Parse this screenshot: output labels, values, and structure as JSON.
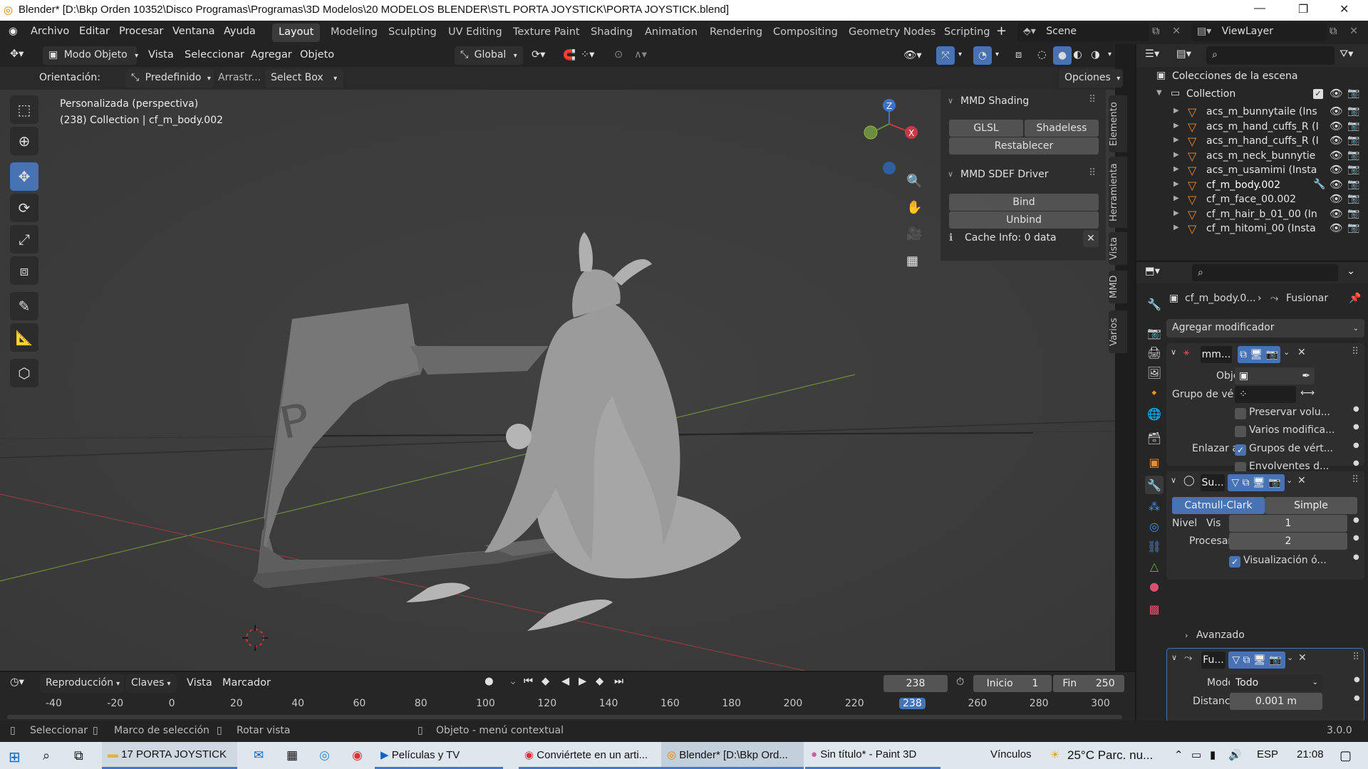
{
  "titlebar": {
    "title": "Blender* [D:\\Bkp Orden 10352\\Disco Programas\\Programas\\3D Modelos\\20 MODELOS BLENDER\\STL PORTA JOYSTICK\\PORTA JOYSTICK.blend]"
  },
  "menu": {
    "items": [
      "Archivo",
      "Editar",
      "Procesar",
      "Ventana",
      "Ayuda"
    ]
  },
  "workspaces": [
    "Layout",
    "Modeling",
    "Sculpting",
    "UV Editing",
    "Texture Paint",
    "Shading",
    "Animation",
    "Rendering",
    "Compositing",
    "Geometry Nodes",
    "Scripting"
  ],
  "scene": {
    "name": "Scene",
    "view_layer": "ViewLayer"
  },
  "viewport_header": {
    "mode": "Modo Objeto",
    "menus": [
      "Vista",
      "Seleccionar",
      "Agregar",
      "Objeto"
    ],
    "transform_orientation": "Global"
  },
  "tool_settings": {
    "orientation_label": "Orientación:",
    "orientation_value": "Predefinido",
    "drag_label": "Arrastr...",
    "drag_value": "Select Box",
    "options": "Opciones"
  },
  "viewport": {
    "view_name": "Personalizada (perspectiva)",
    "info": "(238) Collection | cf_m_body.002"
  },
  "npanel": {
    "tabs": [
      "Elemento",
      "Herramienta",
      "Vista",
      "MMD",
      "Varios"
    ],
    "mmd_shading": {
      "title": "MMD Shading",
      "glsl": "GLSL",
      "shadeless": "Shadeless",
      "reset": "Restablecer"
    },
    "mmd_sdef": {
      "title": "MMD SDEF Driver",
      "bind": "Bind",
      "unbind": "Unbind",
      "cache": "Cache Info: 0 data"
    }
  },
  "outliner": {
    "root": "Colecciones de la escena",
    "collection": "Collection",
    "items": [
      "acs_m_bunnytaile (Ins",
      "acs_m_hand_cuffs_R (I",
      "acs_m_hand_cuffs_R (I",
      "acs_m_neck_bunnytie",
      "acs_m_usamimi (Insta",
      "cf_m_body.002",
      "cf_m_face_00.002",
      "cf_m_hair_b_01_00 (In",
      "cf_m_hitomi_00 (Insta"
    ]
  },
  "properties": {
    "breadcrumb_object": "cf_m_body.0...",
    "breadcrumb_modifier": "Fusionar",
    "add_modifier": "Agregar modificador",
    "mod1": {
      "name": "mm...",
      "object_label": "Objeto",
      "vgroup_label": "Grupo de vé",
      "preserve": "Preservar volu...",
      "multi": "Varios modifica...",
      "bind_to": "Enlazar a",
      "vertex_groups": "Grupos de vért...",
      "envelopes": "Envolventes d..."
    },
    "mod2": {
      "name": "Su...",
      "catmull": "Catmull-Clark",
      "simple": "Simple",
      "level_label": "Nivel",
      "viewport_label": "Vis",
      "viewport_value": "1",
      "render_label": "Procesar",
      "render_value": "2",
      "optimal": "Visualización ó...",
      "advanced": "Avanzado"
    },
    "mod3": {
      "name": "Fu...",
      "mode_label": "Modo",
      "mode_value": "Todo",
      "distance_label": "Distancia",
      "distance_value": "0.001 m"
    }
  },
  "timeline": {
    "menus": [
      "Reproducción",
      "Claves",
      "Vista",
      "Marcador"
    ],
    "current_frame": "238",
    "start_label": "Inicio",
    "start_value": "1",
    "end_label": "Fin",
    "end_value": "250",
    "ruler": [
      "-40",
      "-20",
      "0",
      "20",
      "40",
      "60",
      "80",
      "100",
      "120",
      "140",
      "160",
      "180",
      "200",
      "220",
      "238",
      "260",
      "280",
      "300"
    ]
  },
  "statusbar": {
    "select": "Seleccionar",
    "box_select": "Marco de selección",
    "rotate": "Rotar vista",
    "context": "Objeto - menú contextual",
    "version": "3.0.0"
  },
  "taskbar": {
    "apps": [
      "17 PORTA JOYSTICK",
      "Películas y TV",
      "Conviértete en un arti...",
      "Blender* [D:\\Bkp Ord...",
      "Sin título* - Paint 3D"
    ],
    "links": "Vínculos",
    "weather": "25°C  Parc. nu...",
    "lang": "ESP",
    "time": "21:08"
  }
}
